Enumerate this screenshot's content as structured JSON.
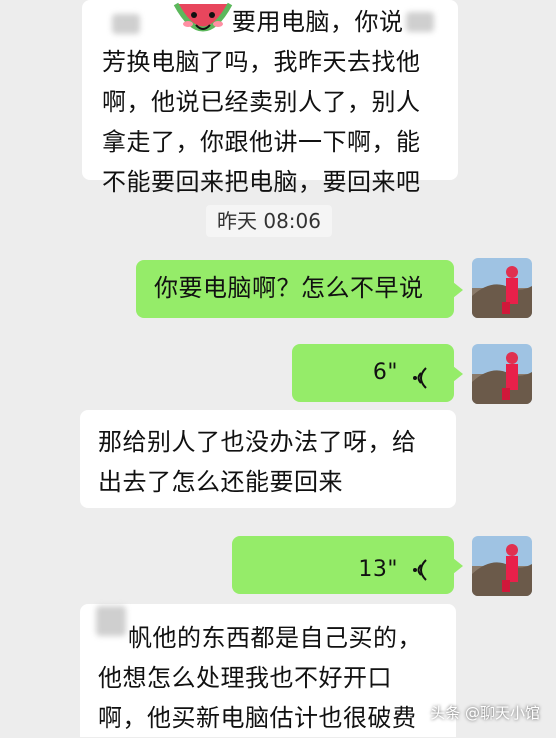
{
  "messages": {
    "m1": {
      "line1": "要用电脑，你说",
      "line2": "芳换电脑了吗，我昨天去找他",
      "line3": "啊，他说已经卖别人了，别人",
      "line4": "拿走了，你跟他讲一下啊，能",
      "line5": "不能要回来把电脑，要回来吧"
    },
    "time": "昨天 08:06",
    "m2": "你要电脑啊？怎么不早说",
    "voice1": "6\"",
    "m3": {
      "line1": "那给别人了也没办法了呀，给",
      "line2": "出去了怎么还能要回来"
    },
    "voice2": "13\"",
    "m4": {
      "line1": "帆他的东西都是自己买的，",
      "line2": "他想怎么处理我也不好开口",
      "line3": "啊，他买新电脑估计也很破费"
    }
  },
  "watermark": "头条 @聊天小馆",
  "colors": {
    "background": "#ededed",
    "sent_bubble": "#95ec69",
    "received_bubble": "#ffffff"
  },
  "icons": [
    "watermelon-emoji-icon",
    "voice-wave-icon",
    "avatar-photo"
  ]
}
